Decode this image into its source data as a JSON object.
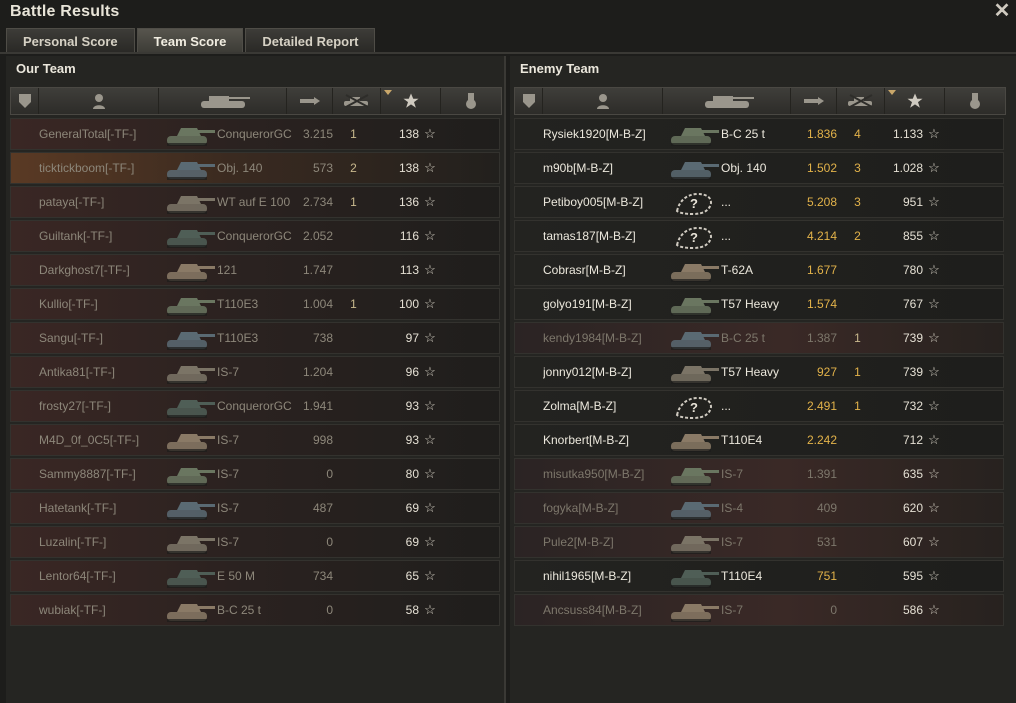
{
  "window": {
    "title": "Battle Results",
    "close_label": "✕"
  },
  "tabs": [
    {
      "label": "Personal Score",
      "active": false
    },
    {
      "label": "Team Score",
      "active": true
    },
    {
      "label": "Detailed Report",
      "active": false
    }
  ],
  "columns": [
    "squad-icon",
    "player-icon",
    "tank-icon",
    "damage-icon",
    "kills-icon",
    "xp-star-icon",
    "medal-icon"
  ],
  "sorted_column": "xp-star-icon",
  "our_team": {
    "title": "Our Team",
    "rows": [
      {
        "name": "GeneralTotal[-TF-]",
        "tank": "ConquerorGC",
        "damage": "3.215",
        "kills": "1",
        "xp": "138",
        "highlight": false
      },
      {
        "name": "ticktickboom[-TF-]",
        "tank": "Obj. 140",
        "damage": "573",
        "kills": "2",
        "xp": "138",
        "highlight": true
      },
      {
        "name": "pataya[-TF-]",
        "tank": "WT auf E 100",
        "damage": "2.734",
        "kills": "1",
        "xp": "136",
        "highlight": false
      },
      {
        "name": "Guiltank[-TF-]",
        "tank": "ConquerorGC",
        "damage": "2.052",
        "kills": "",
        "xp": "116",
        "highlight": false
      },
      {
        "name": "Darkghost7[-TF-]",
        "tank": "121",
        "damage": "1.747",
        "kills": "",
        "xp": "113",
        "highlight": false
      },
      {
        "name": "Kullio[-TF-]",
        "tank": "T110E3",
        "damage": "1.004",
        "kills": "1",
        "xp": "100",
        "highlight": false
      },
      {
        "name": "Sangu[-TF-]",
        "tank": "T110E3",
        "damage": "738",
        "kills": "",
        "xp": "97",
        "highlight": false
      },
      {
        "name": "Antika81[-TF-]",
        "tank": "IS-7",
        "damage": "1.204",
        "kills": "",
        "xp": "96",
        "highlight": false
      },
      {
        "name": "frosty27[-TF-]",
        "tank": "ConquerorGC",
        "damage": "1.941",
        "kills": "",
        "xp": "93",
        "highlight": false
      },
      {
        "name": "M4D_0f_0C5[-TF-]",
        "tank": "IS-7",
        "damage": "998",
        "kills": "",
        "xp": "93",
        "highlight": false
      },
      {
        "name": "Sammy8887[-TF-]",
        "tank": "IS-7",
        "damage": "0",
        "kills": "",
        "xp": "80",
        "highlight": false
      },
      {
        "name": "Hatetank[-TF-]",
        "tank": "IS-7",
        "damage": "487",
        "kills": "",
        "xp": "69",
        "highlight": false
      },
      {
        "name": "Luzalin[-TF-]",
        "tank": "IS-7",
        "damage": "0",
        "kills": "",
        "xp": "69",
        "highlight": false
      },
      {
        "name": "Lentor64[-TF-]",
        "tank": "E 50 M",
        "damage": "734",
        "kills": "",
        "xp": "65",
        "highlight": false
      },
      {
        "name": "wubiak[-TF-]",
        "tank": "B-C 25 t",
        "damage": "0",
        "kills": "",
        "xp": "58",
        "highlight": false
      }
    ]
  },
  "enemy_team": {
    "title": "Enemy Team",
    "rows": [
      {
        "name": "Rysiek1920[M-B-Z]",
        "tank": "B-C 25 t",
        "damage": "1.836",
        "kills": "4",
        "xp": "1.133",
        "alive": true,
        "unknown": false
      },
      {
        "name": "m90b[M-B-Z]",
        "tank": "Obj. 140",
        "damage": "1.502",
        "kills": "3",
        "xp": "1.028",
        "alive": true,
        "unknown": false
      },
      {
        "name": "Petiboy005[M-B-Z]",
        "tank": "...",
        "damage": "5.208",
        "kills": "3",
        "xp": "951",
        "alive": true,
        "unknown": true
      },
      {
        "name": "tamas187[M-B-Z]",
        "tank": "...",
        "damage": "4.214",
        "kills": "2",
        "xp": "855",
        "alive": true,
        "unknown": true
      },
      {
        "name": "Cobrasr[M-B-Z]",
        "tank": "T-62A",
        "damage": "1.677",
        "kills": "",
        "xp": "780",
        "alive": true,
        "unknown": false
      },
      {
        "name": "golyo191[M-B-Z]",
        "tank": "T57 Heavy",
        "damage": "1.574",
        "kills": "",
        "xp": "767",
        "alive": true,
        "unknown": false
      },
      {
        "name": "kendy1984[M-B-Z]",
        "tank": "B-C 25 t",
        "damage": "1.387",
        "kills": "1",
        "xp": "739",
        "alive": false,
        "unknown": false
      },
      {
        "name": "jonny012[M-B-Z]",
        "tank": "T57 Heavy",
        "damage": "927",
        "kills": "1",
        "xp": "739",
        "alive": true,
        "unknown": false
      },
      {
        "name": "Zolma[M-B-Z]",
        "tank": "...",
        "damage": "2.491",
        "kills": "1",
        "xp": "732",
        "alive": true,
        "unknown": true
      },
      {
        "name": "Knorbert[M-B-Z]",
        "tank": "T110E4",
        "damage": "2.242",
        "kills": "",
        "xp": "712",
        "alive": true,
        "unknown": false
      },
      {
        "name": "misutka950[M-B-Z]",
        "tank": "IS-7",
        "damage": "1.391",
        "kills": "",
        "xp": "635",
        "alive": false,
        "unknown": false
      },
      {
        "name": "fogyka[M-B-Z]",
        "tank": "IS-4",
        "damage": "409",
        "kills": "",
        "xp": "620",
        "alive": false,
        "unknown": false
      },
      {
        "name": "Pule2[M-B-Z]",
        "tank": "IS-7",
        "damage": "531",
        "kills": "",
        "xp": "607",
        "alive": false,
        "unknown": false
      },
      {
        "name": "nihil1965[M-B-Z]",
        "tank": "T110E4",
        "damage": "751",
        "kills": "",
        "xp": "595",
        "alive": true,
        "unknown": false
      },
      {
        "name": "Ancsuss84[M-B-Z]",
        "tank": "IS-7",
        "damage": "0",
        "kills": "",
        "xp": "586",
        "alive": false,
        "unknown": false
      }
    ]
  },
  "star_glyph": "☆",
  "unknown_glyph": "?",
  "colors": {
    "accent": "#e2b24a",
    "highlight_row": "#5a3a24",
    "background": "#1d1d1b"
  }
}
